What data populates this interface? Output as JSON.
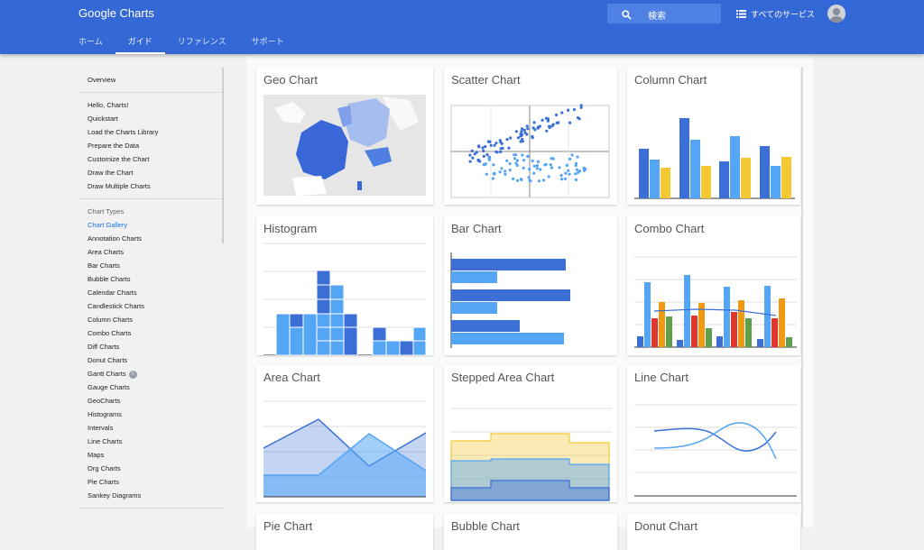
{
  "header": {
    "brand": "Google Charts",
    "search_placeholder": "検索",
    "all_services": "すべてのサービス",
    "tabs": [
      {
        "label": "ホーム",
        "active": false
      },
      {
        "label": "ガイド",
        "active": true
      },
      {
        "label": "リファレンス",
        "active": false
      },
      {
        "label": "サポート",
        "active": false
      }
    ]
  },
  "sidebar": {
    "overview": "Overview",
    "hello_section": [
      "Hello, Charts!",
      "Quickstart",
      "Load the Charts Library",
      "Prepare the Data",
      "Customize the Chart",
      "Draw the Chart",
      "Draw Multiple Charts"
    ],
    "types_section": [
      "Chart Types",
      "Chart Gallery",
      "Annotation Charts",
      "Area Charts",
      "Bar Charts",
      "Bubble Charts",
      "Calendar Charts",
      "Candlestick Charts",
      "Column Charts",
      "Combo Charts",
      "Diff Charts",
      "Donut Charts",
      "Gantt Charts",
      "Gauge Charts",
      "GeoCharts",
      "Histograms",
      "Intervals",
      "Line Charts",
      "Maps",
      "Org Charts",
      "Pie Charts",
      "Sankey Diagrams"
    ],
    "active_item": "Chart Gallery",
    "beta_badge": "!"
  },
  "gallery": {
    "cards": [
      "Geo Chart",
      "Scatter Chart",
      "Column Chart",
      "Histogram",
      "Bar Chart",
      "Combo Chart",
      "Area Chart",
      "Stepped Area Chart",
      "Line Chart",
      "Pie Chart",
      "Bubble Chart",
      "Donut Chart"
    ]
  },
  "colors": {
    "header": "#3468d6",
    "blue": "#3b6fd6",
    "light_blue": "#55a5f5",
    "yellow": "#f3c832",
    "red": "#e0352b",
    "orange": "#f09a14",
    "green": "#5f9e4a",
    "link": "#1a73e8"
  }
}
